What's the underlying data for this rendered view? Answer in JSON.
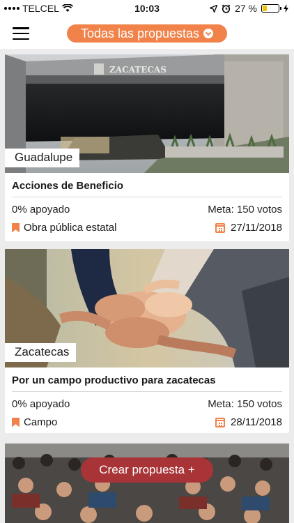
{
  "status": {
    "carrier": "TELCEL",
    "time": "10:03",
    "battery": "27 %",
    "battery_level": 0.27
  },
  "header": {
    "filter_label": "Todas las propuestas"
  },
  "proposals": [
    {
      "location": "Guadalupe",
      "title": "Acciones de Beneficio",
      "support": "0% apoyado",
      "goal": "Meta: 150 votos",
      "category": "Obra pública estatal",
      "date": "27/11/2018",
      "sign_text": "ZACATECAS"
    },
    {
      "location": "Zacatecas",
      "title": "Por un campo productivo para zacatecas",
      "support": "0% apoyado",
      "goal": "Meta: 150 votos",
      "category": "Campo",
      "date": "28/11/2018"
    }
  ],
  "actions": {
    "create_label": "Crear propuesta +"
  },
  "colors": {
    "accent": "#f0824a",
    "create_button": "#a83438"
  }
}
